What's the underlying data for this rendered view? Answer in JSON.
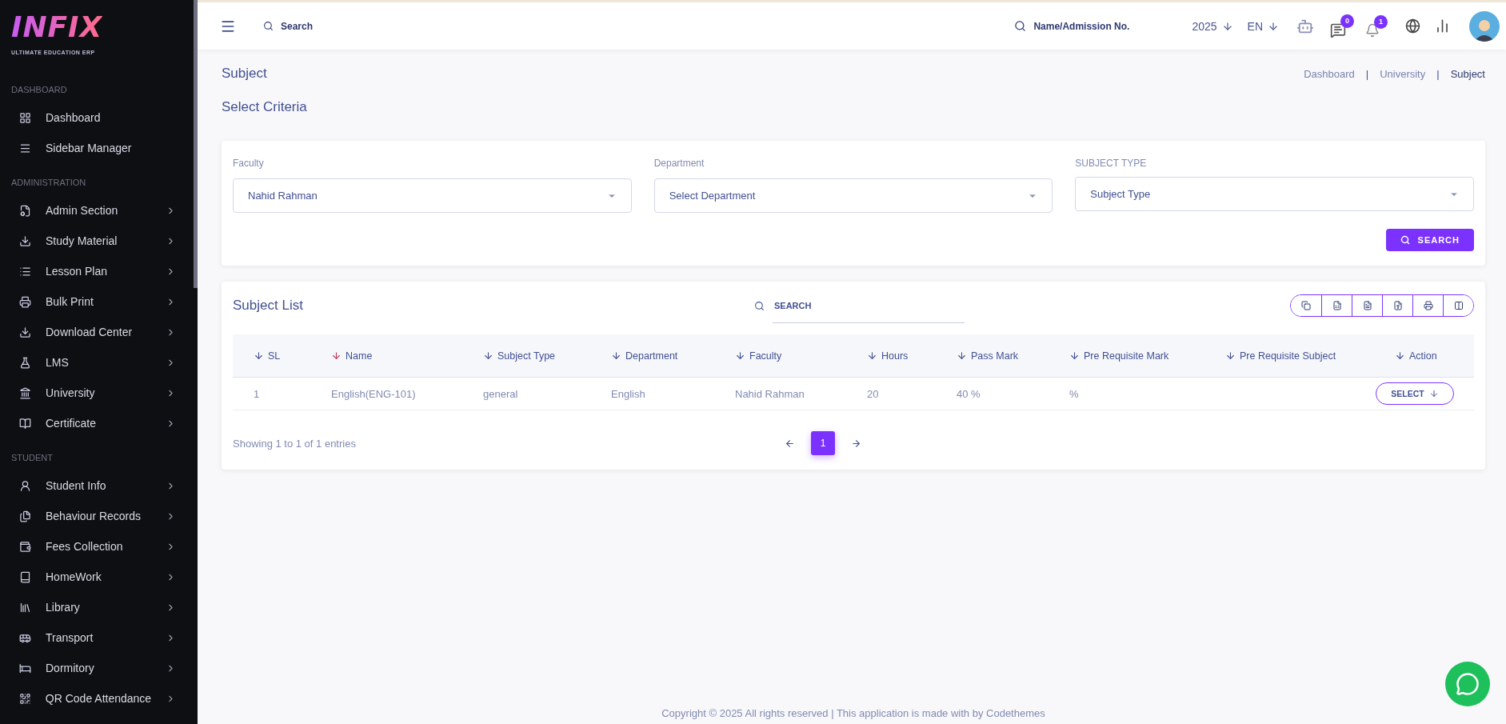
{
  "logo": {
    "wordmark": "INFIX",
    "tagline": "ULTIMATE EDUCATION ERP"
  },
  "sidebar": {
    "sections": [
      {
        "title": "DASHBOARD",
        "items": [
          {
            "label": "Dashboard",
            "has_children": false
          },
          {
            "label": "Sidebar Manager",
            "has_children": false
          }
        ]
      },
      {
        "title": "ADMINISTRATION",
        "items": [
          {
            "label": "Admin Section",
            "has_children": true
          },
          {
            "label": "Study Material",
            "has_children": true
          },
          {
            "label": "Lesson Plan",
            "has_children": true
          },
          {
            "label": "Bulk Print",
            "has_children": true
          },
          {
            "label": "Download Center",
            "has_children": true
          },
          {
            "label": "LMS",
            "has_children": true
          },
          {
            "label": "University",
            "has_children": true
          },
          {
            "label": "Certificate",
            "has_children": true
          }
        ]
      },
      {
        "title": "STUDENT",
        "items": [
          {
            "label": "Student Info",
            "has_children": true
          },
          {
            "label": "Behaviour Records",
            "has_children": true
          },
          {
            "label": "Fees Collection",
            "has_children": true
          },
          {
            "label": "HomeWork",
            "has_children": true
          },
          {
            "label": "Library",
            "has_children": true
          },
          {
            "label": "Transport",
            "has_children": true
          },
          {
            "label": "Dormitory",
            "has_children": true
          },
          {
            "label": "QR Code Attendance",
            "has_children": true
          }
        ]
      }
    ]
  },
  "header": {
    "search": {
      "placeholder": "Search"
    },
    "student_search": {
      "placeholder": "Name/Admission No."
    },
    "year": "2025",
    "language": "EN",
    "messages_count": "0",
    "notifications_count": "1"
  },
  "page": {
    "title": "Subject",
    "breadcrumb": [
      "Dashboard",
      "University",
      "Subject"
    ],
    "breadcrumb_separator": "|",
    "section_title": "Select Criteria"
  },
  "criteria": {
    "fields": [
      {
        "label": "Faculty",
        "value": "Nahid Rahman"
      },
      {
        "label": "Department",
        "value": "Select Department"
      },
      {
        "label": "SUBJECT TYPE",
        "value": "Subject Type"
      }
    ],
    "search_button": "SEARCH"
  },
  "subject_list": {
    "title": "Subject List",
    "search": {
      "placeholder": "SEARCH"
    },
    "columns": [
      {
        "label": "SL",
        "sorted": false
      },
      {
        "label": "Name",
        "sorted": true
      },
      {
        "label": "Subject Type",
        "sorted": false
      },
      {
        "label": "Department",
        "sorted": false
      },
      {
        "label": "Faculty",
        "sorted": false
      },
      {
        "label": "Hours",
        "sorted": false
      },
      {
        "label": "Pass Mark",
        "sorted": false
      },
      {
        "label": "Pre Requisite Mark",
        "sorted": false
      },
      {
        "label": "Pre Requisite Subject",
        "sorted": false
      },
      {
        "label": "Action",
        "sorted": false
      }
    ],
    "rows": [
      {
        "cells": [
          "1",
          "English(ENG-101)",
          "general",
          "English",
          "Nahid Rahman",
          "20",
          "40 %",
          "%"
        ],
        "action": "SELECT"
      }
    ],
    "info": "Showing 1 to 1 of 1 entries",
    "pages": [
      {
        "label": "1",
        "selected": true
      }
    ]
  },
  "footer": "Copyright © 2025 All rights reserved | This application is made with by Codethemes"
}
